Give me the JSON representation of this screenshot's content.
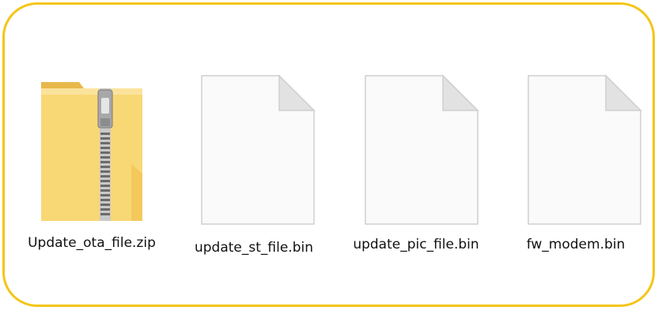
{
  "files": [
    {
      "name": "Update_ota_file.zip",
      "icon": "zip-folder-icon",
      "type": "zip"
    },
    {
      "name": "update_st_file.bin",
      "icon": "blank-file-icon",
      "type": "bin"
    },
    {
      "name": "update_pic_file.bin",
      "icon": "blank-file-icon",
      "type": "bin"
    },
    {
      "name": "fw_modem.bin",
      "icon": "blank-file-icon",
      "type": "bin"
    }
  ],
  "colors": {
    "frame_border": "#f5c518",
    "folder_yellow": "#f8d775",
    "file_white": "#fafafa"
  }
}
